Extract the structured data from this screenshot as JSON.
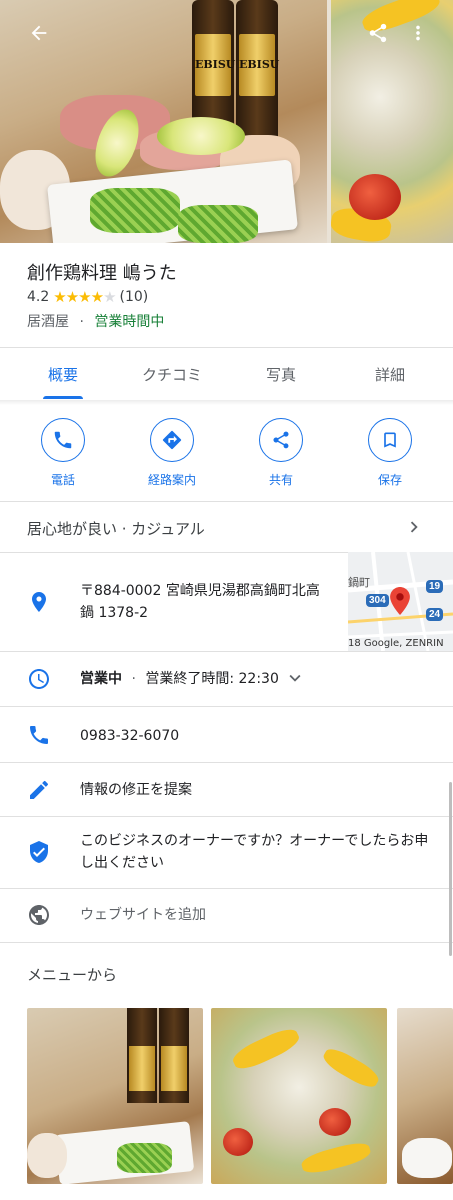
{
  "place": {
    "name": "創作鶏料理 嶋うた",
    "rating": "4.2",
    "stars_filled": 4,
    "stars_total": 5,
    "review_count": "(10)",
    "category": "居酒屋",
    "separator": "·",
    "status": "営業時間中"
  },
  "photos": {
    "bottle_label": "EBISU",
    "bottle_label_left": "EBISU"
  },
  "tabs": [
    {
      "label": "概要"
    },
    {
      "label": "クチコミ"
    },
    {
      "label": "写真"
    },
    {
      "label": "詳細"
    }
  ],
  "actions": [
    {
      "label": "電話",
      "icon": "phone-icon"
    },
    {
      "label": "経路案内",
      "icon": "directions-icon"
    },
    {
      "label": "共有",
      "icon": "share-icon"
    },
    {
      "label": "保存",
      "icon": "bookmark-icon"
    }
  ],
  "ambience": "居心地が良い · カジュアル",
  "address": "〒884-0002 宮崎県児湯郡高鍋町北高鍋 1378-2",
  "map": {
    "town_label": "鍋町",
    "route_304": "304",
    "route_19": "19",
    "route_24": "24",
    "attribution": "18 Google, ZENRIN"
  },
  "hours": {
    "status": "営業中",
    "separator": "·",
    "closing": "営業終了時間: 22:30"
  },
  "phone": "0983-32-6070",
  "suggest_edit": "情報の修正を提案",
  "owner_prompt": "このビジネスのオーナーですか？オーナーでしたらお申し出ください",
  "add_website": "ウェブサイトを追加",
  "menu_section_title": "メニューから",
  "colors": {
    "accent": "#1a73e8",
    "open_green": "#188038",
    "star": "#fbbc04",
    "map_pin": "#ea4335"
  }
}
